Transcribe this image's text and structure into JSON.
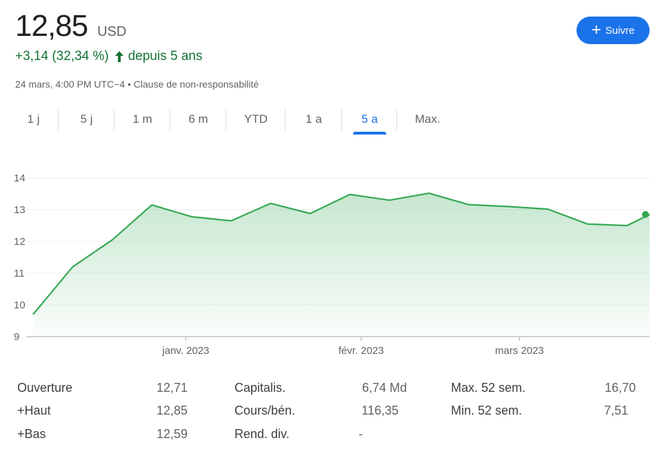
{
  "quote": {
    "price": "12,85",
    "currency": "USD",
    "change": "+3,14 (32,34 %)",
    "change_period": "depuis 5 ans",
    "timestamp": "24 mars, 4:00 PM UTC−4 •",
    "disclaimer": "Clause de non-responsabilité"
  },
  "follow_button": {
    "label": "Suivre"
  },
  "colors": {
    "accent": "#1a73e8",
    "positive": "#137333",
    "line": "#34a853"
  },
  "tabs": [
    {
      "label": "1 j"
    },
    {
      "label": "5 j"
    },
    {
      "label": "1 m"
    },
    {
      "label": "6 m"
    },
    {
      "label": "YTD"
    },
    {
      "label": "1 a"
    },
    {
      "label": "5 a",
      "active": true
    },
    {
      "label": "Max."
    }
  ],
  "chart_data": {
    "type": "area",
    "title": "",
    "xlabel": "",
    "ylabel": "",
    "ylim": [
      9,
      14
    ],
    "yticks": [
      9,
      10,
      11,
      12,
      13,
      14
    ],
    "xtick_labels": [
      "janv. 2023",
      "févr. 2023",
      "mars 2023"
    ],
    "x": [
      "2022-12-05",
      "2022-12-12",
      "2022-12-19",
      "2022-12-26",
      "2023-01-02",
      "2023-01-09",
      "2023-01-16",
      "2023-01-23",
      "2023-01-30",
      "2023-02-06",
      "2023-02-13",
      "2023-02-20",
      "2023-02-27",
      "2023-03-06",
      "2023-03-13",
      "2023-03-20",
      "2023-03-24"
    ],
    "series": [
      {
        "values": [
          9.7,
          11.2,
          12.05,
          13.15,
          12.78,
          12.65,
          13.2,
          12.88,
          13.48,
          13.3,
          13.52,
          13.16,
          13.1,
          13.02,
          12.55,
          12.5,
          12.85
        ]
      }
    ],
    "grid": true,
    "legend": "none"
  },
  "stats": [
    {
      "label": "Ouverture",
      "value": "12,71"
    },
    {
      "label": "+Haut",
      "value": "12,85"
    },
    {
      "label": "+Bas",
      "value": "12,59"
    },
    {
      "label": "Capitalis.",
      "value": "6,74 Md"
    },
    {
      "label": "Cours/bén.",
      "value": "116,35"
    },
    {
      "label": "Rend. div.",
      "value": "-"
    },
    {
      "label": "Max. 52 sem.",
      "value": "16,70"
    },
    {
      "label": "Min. 52 sem.",
      "value": "7,51"
    }
  ]
}
